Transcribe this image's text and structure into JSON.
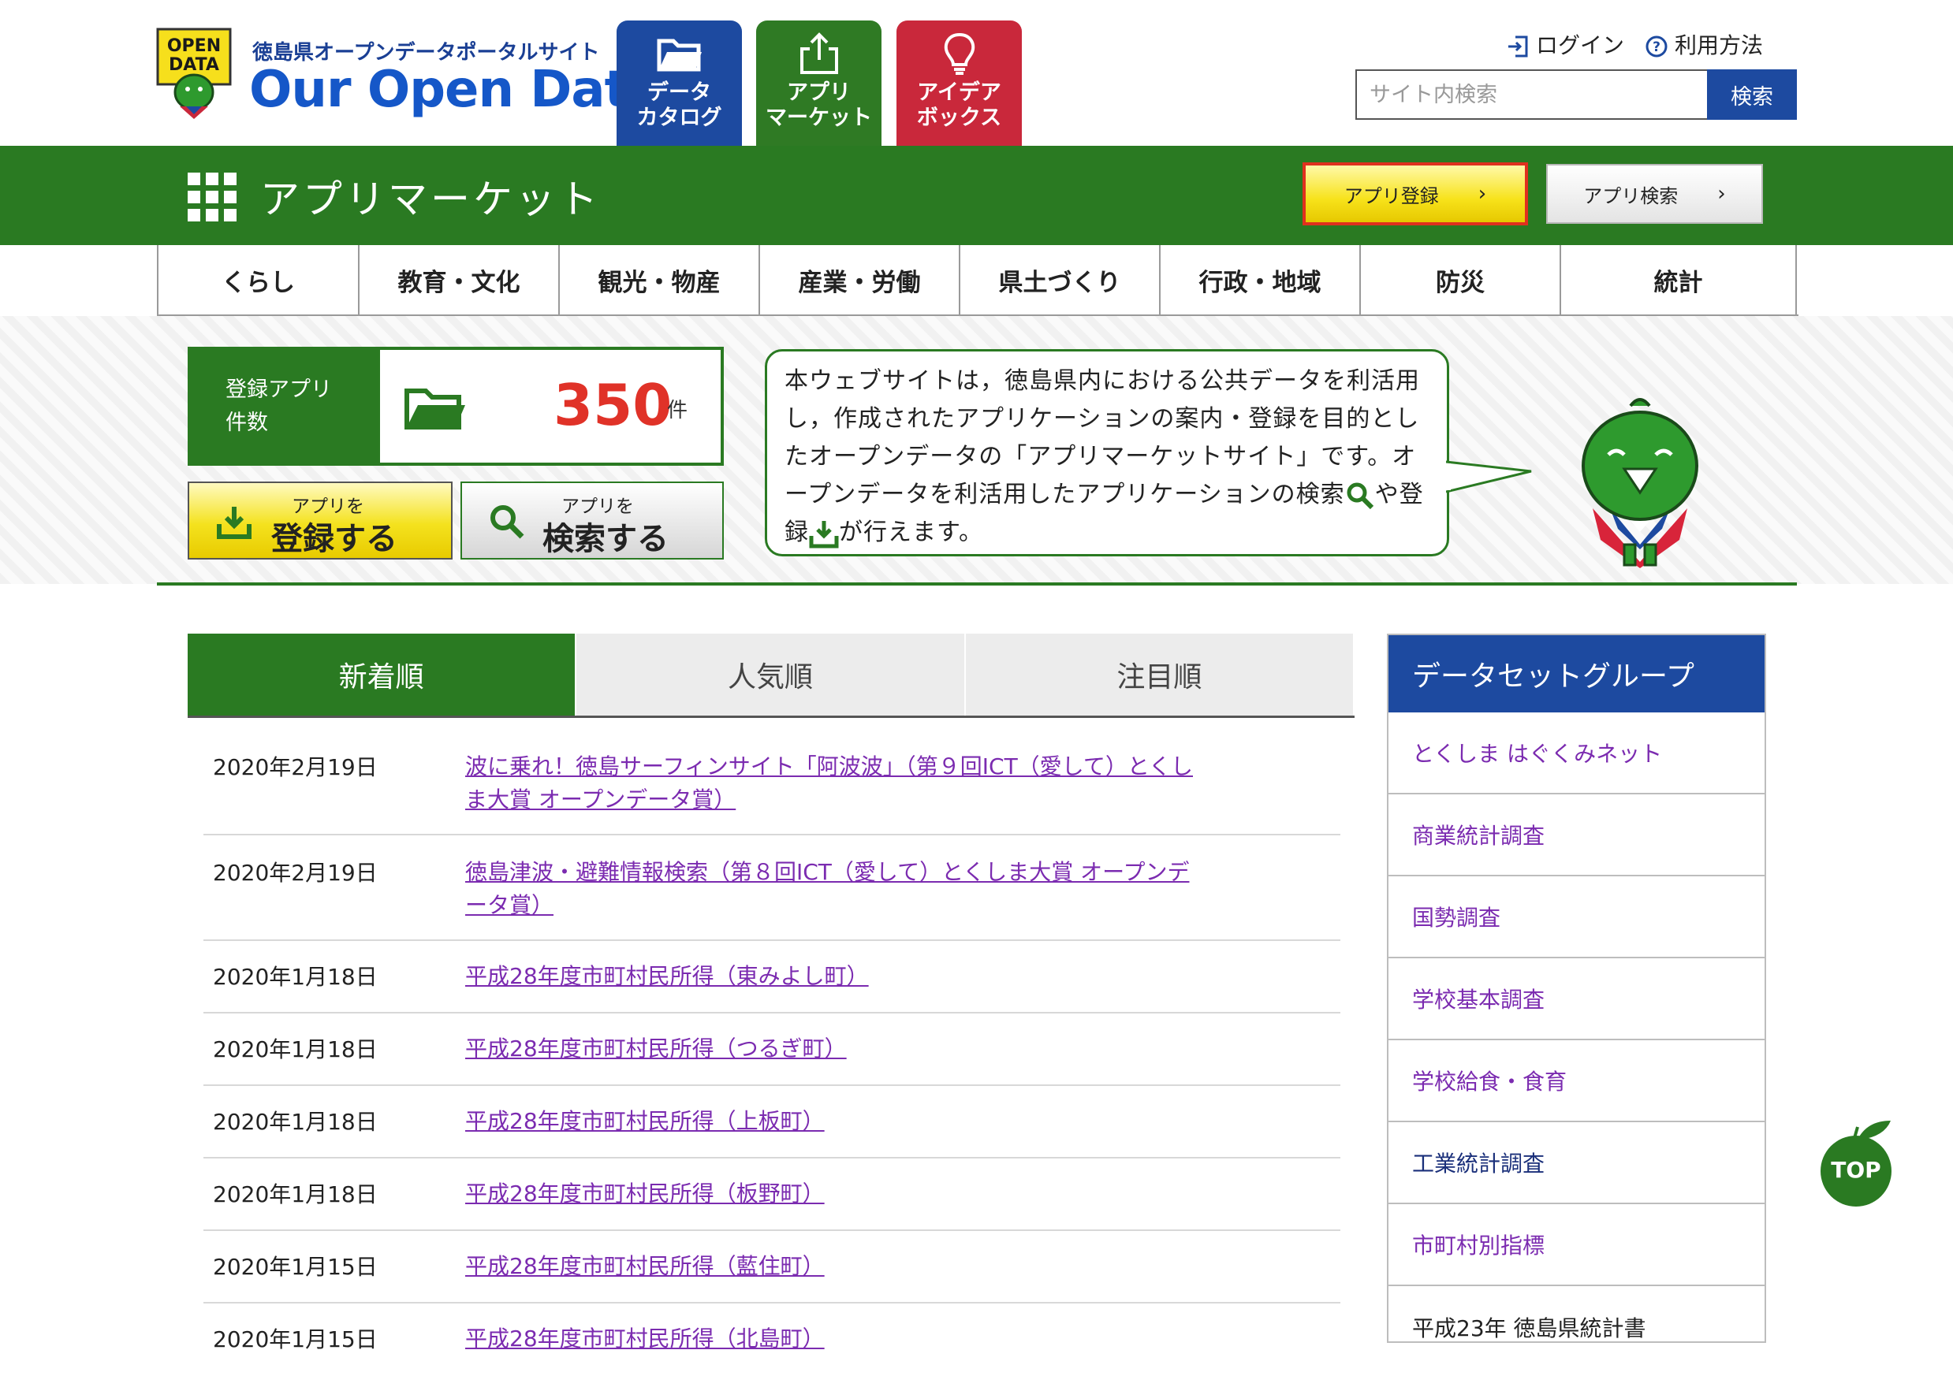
{
  "header": {
    "logo_badge_text": "OPEN DATA",
    "logo_tagline": "徳島県オープンデータポータルサイト",
    "logo_name": "Our Open Data",
    "nav_tiles": [
      {
        "label_line1": "データ",
        "label_line2": "カタログ",
        "icon": "folder-icon"
      },
      {
        "label_line1": "アプリ",
        "label_line2": "マーケット",
        "icon": "upload-icon"
      },
      {
        "label_line1": "アイデア",
        "label_line2": "ボックス",
        "icon": "lightbulb-icon"
      }
    ],
    "login": "ログイン",
    "help": "利用方法",
    "search_placeholder": "サイト内検索",
    "search_button": "検索"
  },
  "section": {
    "title": "アプリマーケット",
    "register_button": "アプリ登録",
    "search_button": "アプリ検索"
  },
  "categories": [
    "くらし",
    "教育・文化",
    "観光・物産",
    "産業・労働",
    "県土づくり",
    "行政・地域",
    "防災",
    "統計"
  ],
  "intro": {
    "count_label_line1": "登録アプリ",
    "count_label_line2": "件数",
    "count_value": "350",
    "count_unit": "件",
    "register_small": "アプリを",
    "register_large": "登録する",
    "search_small": "アプリを",
    "search_large": "検索する",
    "bubble_part1": "本ウェブサイトは，徳島県内における公共データを利活用し，作成されたアプリケーションの案内・登録を目的としたオープンデータの「アプリマーケットサイト」です。オープンデータを利活用したアプリケーションの検索",
    "bubble_part2": "や登録",
    "bubble_part3": "が行えます。"
  },
  "tabs": [
    {
      "label": "新着順",
      "active": true
    },
    {
      "label": "人気順",
      "active": false
    },
    {
      "label": "注目順",
      "active": false
    }
  ],
  "news": [
    {
      "date": "2020年2月19日",
      "title": "波に乗れ！徳島サーフィンサイト「阿波波」（第９回ICT（愛して）とくしま大賞 オープンデータ賞）"
    },
    {
      "date": "2020年2月19日",
      "title": "徳島津波・避難情報検索（第８回ICT（愛して）とくしま大賞 オープンデータ賞）"
    },
    {
      "date": "2020年1月18日",
      "title": "平成28年度市町村民所得（東みよし町）"
    },
    {
      "date": "2020年1月18日",
      "title": "平成28年度市町村民所得（つるぎ町）"
    },
    {
      "date": "2020年1月18日",
      "title": "平成28年度市町村民所得（上板町）"
    },
    {
      "date": "2020年1月18日",
      "title": "平成28年度市町村民所得（板野町）"
    },
    {
      "date": "2020年1月15日",
      "title": "平成28年度市町村民所得（藍住町）"
    },
    {
      "date": "2020年1月15日",
      "title": "平成28年度市町村民所得（北島町）"
    }
  ],
  "sidebar": {
    "title": "データセットグループ",
    "items": [
      "とくしま はぐくみネット",
      "商業統計調査",
      "国勢調査",
      "学校基本調査",
      "学校給食・食育",
      "工業統計調査",
      "市町村別指標",
      "平成23年 徳島県統計書"
    ]
  },
  "top_button": "TOP",
  "colors": {
    "green": "#2a7a22",
    "blue": "#1d4aa0",
    "red": "#c9283b",
    "count_red": "#e03228",
    "link_purple": "#7b2bb0",
    "yellow": "#f4e21e"
  }
}
